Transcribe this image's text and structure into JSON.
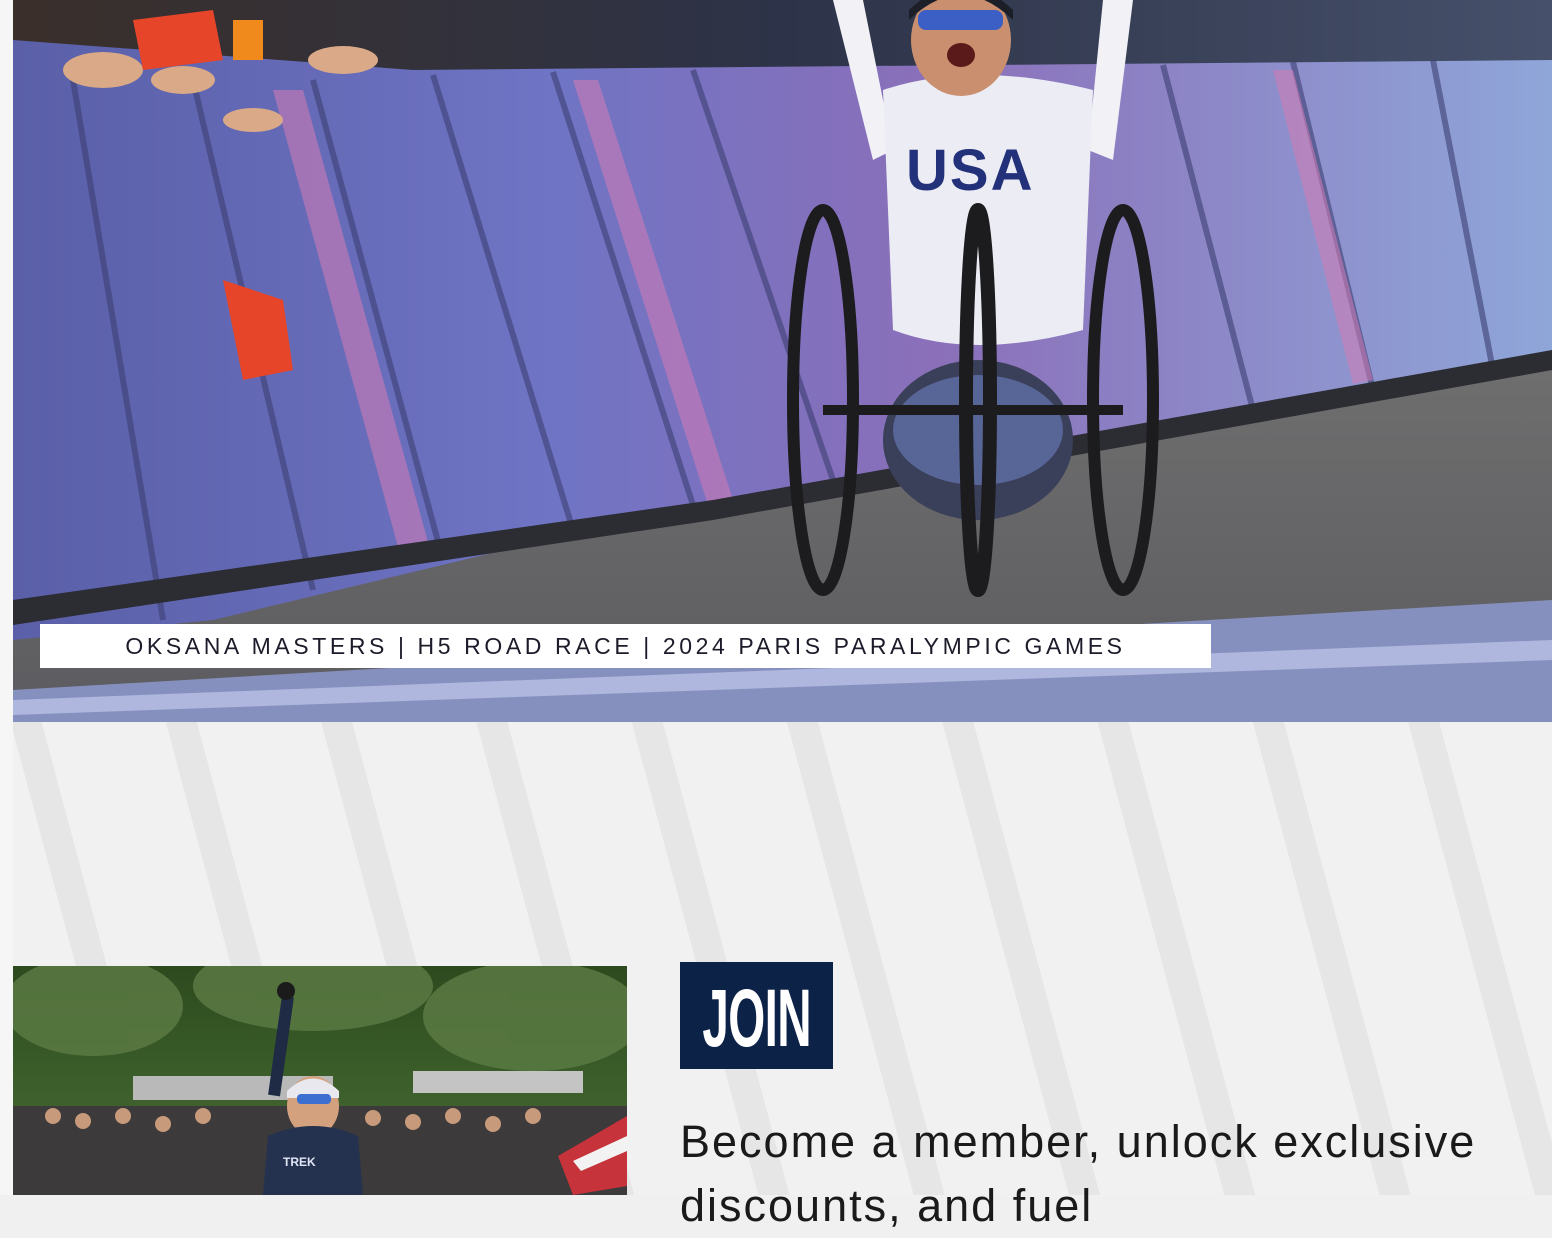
{
  "hero": {
    "caption": "OKSANA MASTERS | H5 ROAD RACE | 2024 PARIS PARALYMPIC GAMES",
    "jersey_text": "USA"
  },
  "join": {
    "badge_label": "JOIN",
    "body_text": "Become a member, unlock exclusive discounts, and fuel"
  },
  "colors": {
    "navy": "#0d2247",
    "background": "#f0f0f0",
    "caption_bg": "#ffffff"
  }
}
